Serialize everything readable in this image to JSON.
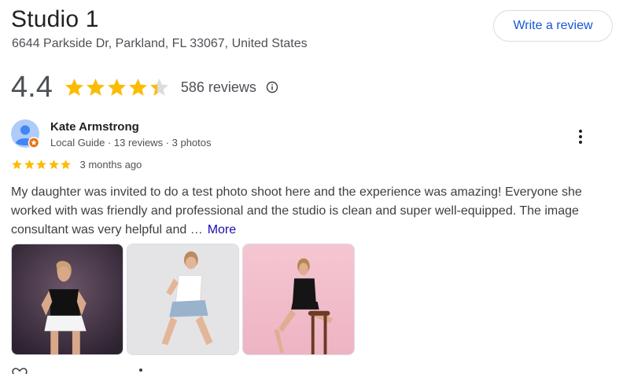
{
  "business": {
    "name": "Studio 1",
    "address": "6644 Parkside Dr, Parkland, FL 33067, United States",
    "write_review_label": "Write a review"
  },
  "rating": {
    "value": "4.4",
    "stars_filled": 4.4,
    "reviews_label": "586 reviews",
    "info_icon": "info-icon"
  },
  "review": {
    "author": "Kate Armstrong",
    "meta": "Local Guide · 13 reviews · 3 photos",
    "stars": 5,
    "time": "3 months ago",
    "text": "My daughter was invited to do a test photo shoot here and the experience was amazing! Everyone she worked with was friendly and professional and the studio is clean and super well-equipped. The image consultant was very helpful and …",
    "more_label": "More",
    "photos": [
      {
        "name": "photo-1",
        "bg": "#4a3a4a"
      },
      {
        "name": "photo-2",
        "bg": "#e6e6e8"
      },
      {
        "name": "photo-3",
        "bg": "#f3c4cf"
      }
    ]
  },
  "colors": {
    "star": "#fbbc04",
    "star_empty": "#dadce0",
    "link": "#1a0dab",
    "button_text": "#1558d6"
  }
}
